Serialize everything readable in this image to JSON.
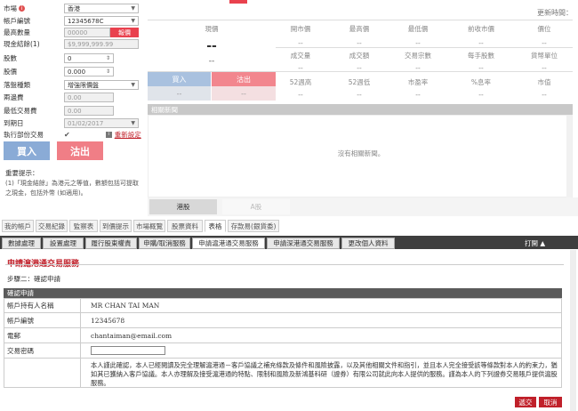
{
  "order": {
    "market_label": "市場",
    "market_value": "香港",
    "account_label": "帳戶編號",
    "account_value": "12345678C",
    "max_qty_label": "最高數量",
    "max_qty_value": "00000",
    "max_qty_btn": "報價",
    "cash_label": "現金結餘(1)",
    "cash_value": "$9,999,999.99",
    "stock_label": "股數",
    "stock_value": "0",
    "price_label": "股價",
    "price_value": "0.000",
    "order_type_label": "落盤種類",
    "order_type_value": "增強限價盤",
    "fee_label": "兩邊費",
    "fee_value": "0.00",
    "min_amount_label": "最低交易費",
    "min_amount_value": "0.00",
    "expiry_label": "到期日",
    "expiry_value": "01/02/2017",
    "partial_label": "執行部份交易",
    "reset_label": "重新設定",
    "buy_label": "買入",
    "sell_label": "沽出",
    "notes_title": "重要提示：",
    "notes_text": "(1)「現金結餘」為港元之等值，數額包括可提取之現金，包括外幣 (如適用)。"
  },
  "quote": {
    "update_label": "更新時間：",
    "nominal_label": "現價",
    "nominal_value": "--",
    "nominal_change": "--",
    "headers_row1": [
      "開市價",
      "最高價",
      "最低價",
      "前收市價",
      "價位"
    ],
    "values_row1": [
      "--",
      "--",
      "--",
      "--",
      "--"
    ],
    "headers_row2": [
      "成交量",
      "成交額",
      "交易宗數",
      "每手股數",
      "貨幣單位"
    ],
    "values_row2": [
      "--",
      "--",
      "--",
      "--",
      "--"
    ],
    "headers_row3": [
      "52週高",
      "52週低",
      "市盈率",
      "%息率",
      "市值"
    ],
    "values_row3": [
      "--",
      "--",
      "--",
      "--",
      "--"
    ],
    "bid_label": "買入",
    "ask_label": "沽出",
    "bid_value": "--",
    "ask_value": "--",
    "news_title": "相關新聞",
    "no_news": "沒有相關新聞。",
    "tab_hk": "港股",
    "tab_a": "A股"
  },
  "main_tabs": [
    "我的帳戶",
    "交易紀錄",
    "監察表",
    "到價提示",
    "市場概覽",
    "股票資料",
    "表格",
    "存款易(銀貨委)"
  ],
  "sub_tabs": [
    "數據處理",
    "設置處理",
    "履行股東權責",
    "申購/取消服務",
    "申請滬港通交易服務",
    "申請深港通交易服務",
    "更改個人資料"
  ],
  "print_label": "打開 ▲",
  "form": {
    "title": "申請滬港通交易服務",
    "step": "步驟二：確認申請",
    "section": "確認申請",
    "name_label": "帳戶持有人名稱",
    "name_value": "MR CHAN TAI MAN",
    "acct_label": "帳戶編號",
    "acct_value": "12345678",
    "email_label": "電郵",
    "email_value": "chantaiman@email.com",
    "pwd_label": "交易密碼",
    "pwd_value": "",
    "declaration": "本人謹此確認，本人已經閱讀及完全理解滬港通－客戶協議之補充條款及條件和風險披露，以及其他相關文件和指引，並且本人完全接受該等條款對本人的約束力，猶如其已獲納入客戶協議。本人亦理解及接受滬港通的特點、限制和風險及新鴻基科研（證券）有限公司就此向本人提供的服務。謹為本人的下列證券交易賬戶提供滬股服務。",
    "submit_label": "遞交",
    "cancel_label": "取消"
  }
}
